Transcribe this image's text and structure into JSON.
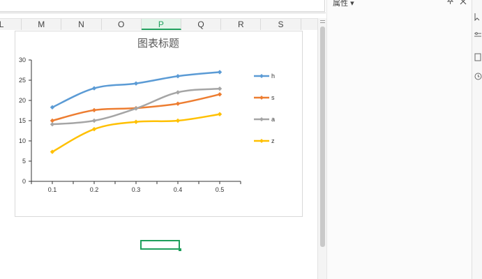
{
  "columns": [
    {
      "label": "L"
    },
    {
      "label": "M"
    },
    {
      "label": "N"
    },
    {
      "label": "O"
    },
    {
      "label": "P",
      "active": true
    },
    {
      "label": "Q"
    },
    {
      "label": "R"
    },
    {
      "label": "S"
    }
  ],
  "panel": {
    "title": "属性",
    "title_arrow": "▾",
    "pin_icon": "pin-icon",
    "close_icon": "close-icon"
  },
  "colors": {
    "accent": "#1ea05c",
    "h": "#5b9bd5",
    "s": "#ed7d31",
    "a": "#a5a5a5",
    "z": "#ffc000"
  },
  "chart_data": {
    "type": "line",
    "title": "图表标题",
    "x": [
      0.1,
      0.2,
      0.3,
      0.4,
      0.5
    ],
    "x_tick_labels": [
      "0.1",
      "0.2",
      "0.3",
      "0.4",
      "0.5"
    ],
    "ylim": [
      0,
      30
    ],
    "y_ticks": [
      0,
      5,
      10,
      15,
      20,
      25,
      30
    ],
    "smooth": true,
    "markers": "diamond",
    "legend_position": "right",
    "grid": false,
    "series": [
      {
        "name": "h",
        "values": [
          18.3,
          23.0,
          24.2,
          26.0,
          27.0
        ]
      },
      {
        "name": "s",
        "values": [
          15.0,
          17.6,
          18.1,
          19.2,
          21.5
        ]
      },
      {
        "name": "a",
        "values": [
          14.1,
          15.0,
          18.0,
          22.0,
          22.9
        ]
      },
      {
        "name": "z",
        "values": [
          7.3,
          12.9,
          14.7,
          15.0,
          16.6
        ]
      }
    ]
  }
}
